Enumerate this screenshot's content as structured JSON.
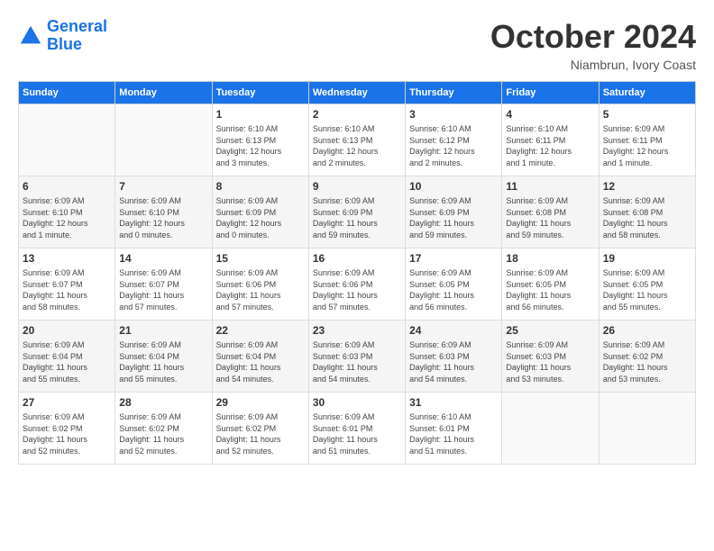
{
  "header": {
    "logo_line1": "General",
    "logo_line2": "Blue",
    "month": "October 2024",
    "location": "Niambrun, Ivory Coast"
  },
  "days_of_week": [
    "Sunday",
    "Monday",
    "Tuesday",
    "Wednesday",
    "Thursday",
    "Friday",
    "Saturday"
  ],
  "weeks": [
    [
      {
        "day": "",
        "info": ""
      },
      {
        "day": "",
        "info": ""
      },
      {
        "day": "1",
        "info": "Sunrise: 6:10 AM\nSunset: 6:13 PM\nDaylight: 12 hours\nand 3 minutes."
      },
      {
        "day": "2",
        "info": "Sunrise: 6:10 AM\nSunset: 6:13 PM\nDaylight: 12 hours\nand 2 minutes."
      },
      {
        "day": "3",
        "info": "Sunrise: 6:10 AM\nSunset: 6:12 PM\nDaylight: 12 hours\nand 2 minutes."
      },
      {
        "day": "4",
        "info": "Sunrise: 6:10 AM\nSunset: 6:11 PM\nDaylight: 12 hours\nand 1 minute."
      },
      {
        "day": "5",
        "info": "Sunrise: 6:09 AM\nSunset: 6:11 PM\nDaylight: 12 hours\nand 1 minute."
      }
    ],
    [
      {
        "day": "6",
        "info": "Sunrise: 6:09 AM\nSunset: 6:10 PM\nDaylight: 12 hours\nand 1 minute."
      },
      {
        "day": "7",
        "info": "Sunrise: 6:09 AM\nSunset: 6:10 PM\nDaylight: 12 hours\nand 0 minutes."
      },
      {
        "day": "8",
        "info": "Sunrise: 6:09 AM\nSunset: 6:09 PM\nDaylight: 12 hours\nand 0 minutes."
      },
      {
        "day": "9",
        "info": "Sunrise: 6:09 AM\nSunset: 6:09 PM\nDaylight: 11 hours\nand 59 minutes."
      },
      {
        "day": "10",
        "info": "Sunrise: 6:09 AM\nSunset: 6:09 PM\nDaylight: 11 hours\nand 59 minutes."
      },
      {
        "day": "11",
        "info": "Sunrise: 6:09 AM\nSunset: 6:08 PM\nDaylight: 11 hours\nand 59 minutes."
      },
      {
        "day": "12",
        "info": "Sunrise: 6:09 AM\nSunset: 6:08 PM\nDaylight: 11 hours\nand 58 minutes."
      }
    ],
    [
      {
        "day": "13",
        "info": "Sunrise: 6:09 AM\nSunset: 6:07 PM\nDaylight: 11 hours\nand 58 minutes."
      },
      {
        "day": "14",
        "info": "Sunrise: 6:09 AM\nSunset: 6:07 PM\nDaylight: 11 hours\nand 57 minutes."
      },
      {
        "day": "15",
        "info": "Sunrise: 6:09 AM\nSunset: 6:06 PM\nDaylight: 11 hours\nand 57 minutes."
      },
      {
        "day": "16",
        "info": "Sunrise: 6:09 AM\nSunset: 6:06 PM\nDaylight: 11 hours\nand 57 minutes."
      },
      {
        "day": "17",
        "info": "Sunrise: 6:09 AM\nSunset: 6:05 PM\nDaylight: 11 hours\nand 56 minutes."
      },
      {
        "day": "18",
        "info": "Sunrise: 6:09 AM\nSunset: 6:05 PM\nDaylight: 11 hours\nand 56 minutes."
      },
      {
        "day": "19",
        "info": "Sunrise: 6:09 AM\nSunset: 6:05 PM\nDaylight: 11 hours\nand 55 minutes."
      }
    ],
    [
      {
        "day": "20",
        "info": "Sunrise: 6:09 AM\nSunset: 6:04 PM\nDaylight: 11 hours\nand 55 minutes."
      },
      {
        "day": "21",
        "info": "Sunrise: 6:09 AM\nSunset: 6:04 PM\nDaylight: 11 hours\nand 55 minutes."
      },
      {
        "day": "22",
        "info": "Sunrise: 6:09 AM\nSunset: 6:04 PM\nDaylight: 11 hours\nand 54 minutes."
      },
      {
        "day": "23",
        "info": "Sunrise: 6:09 AM\nSunset: 6:03 PM\nDaylight: 11 hours\nand 54 minutes."
      },
      {
        "day": "24",
        "info": "Sunrise: 6:09 AM\nSunset: 6:03 PM\nDaylight: 11 hours\nand 54 minutes."
      },
      {
        "day": "25",
        "info": "Sunrise: 6:09 AM\nSunset: 6:03 PM\nDaylight: 11 hours\nand 53 minutes."
      },
      {
        "day": "26",
        "info": "Sunrise: 6:09 AM\nSunset: 6:02 PM\nDaylight: 11 hours\nand 53 minutes."
      }
    ],
    [
      {
        "day": "27",
        "info": "Sunrise: 6:09 AM\nSunset: 6:02 PM\nDaylight: 11 hours\nand 52 minutes."
      },
      {
        "day": "28",
        "info": "Sunrise: 6:09 AM\nSunset: 6:02 PM\nDaylight: 11 hours\nand 52 minutes."
      },
      {
        "day": "29",
        "info": "Sunrise: 6:09 AM\nSunset: 6:02 PM\nDaylight: 11 hours\nand 52 minutes."
      },
      {
        "day": "30",
        "info": "Sunrise: 6:09 AM\nSunset: 6:01 PM\nDaylight: 11 hours\nand 51 minutes."
      },
      {
        "day": "31",
        "info": "Sunrise: 6:10 AM\nSunset: 6:01 PM\nDaylight: 11 hours\nand 51 minutes."
      },
      {
        "day": "",
        "info": ""
      },
      {
        "day": "",
        "info": ""
      }
    ]
  ]
}
